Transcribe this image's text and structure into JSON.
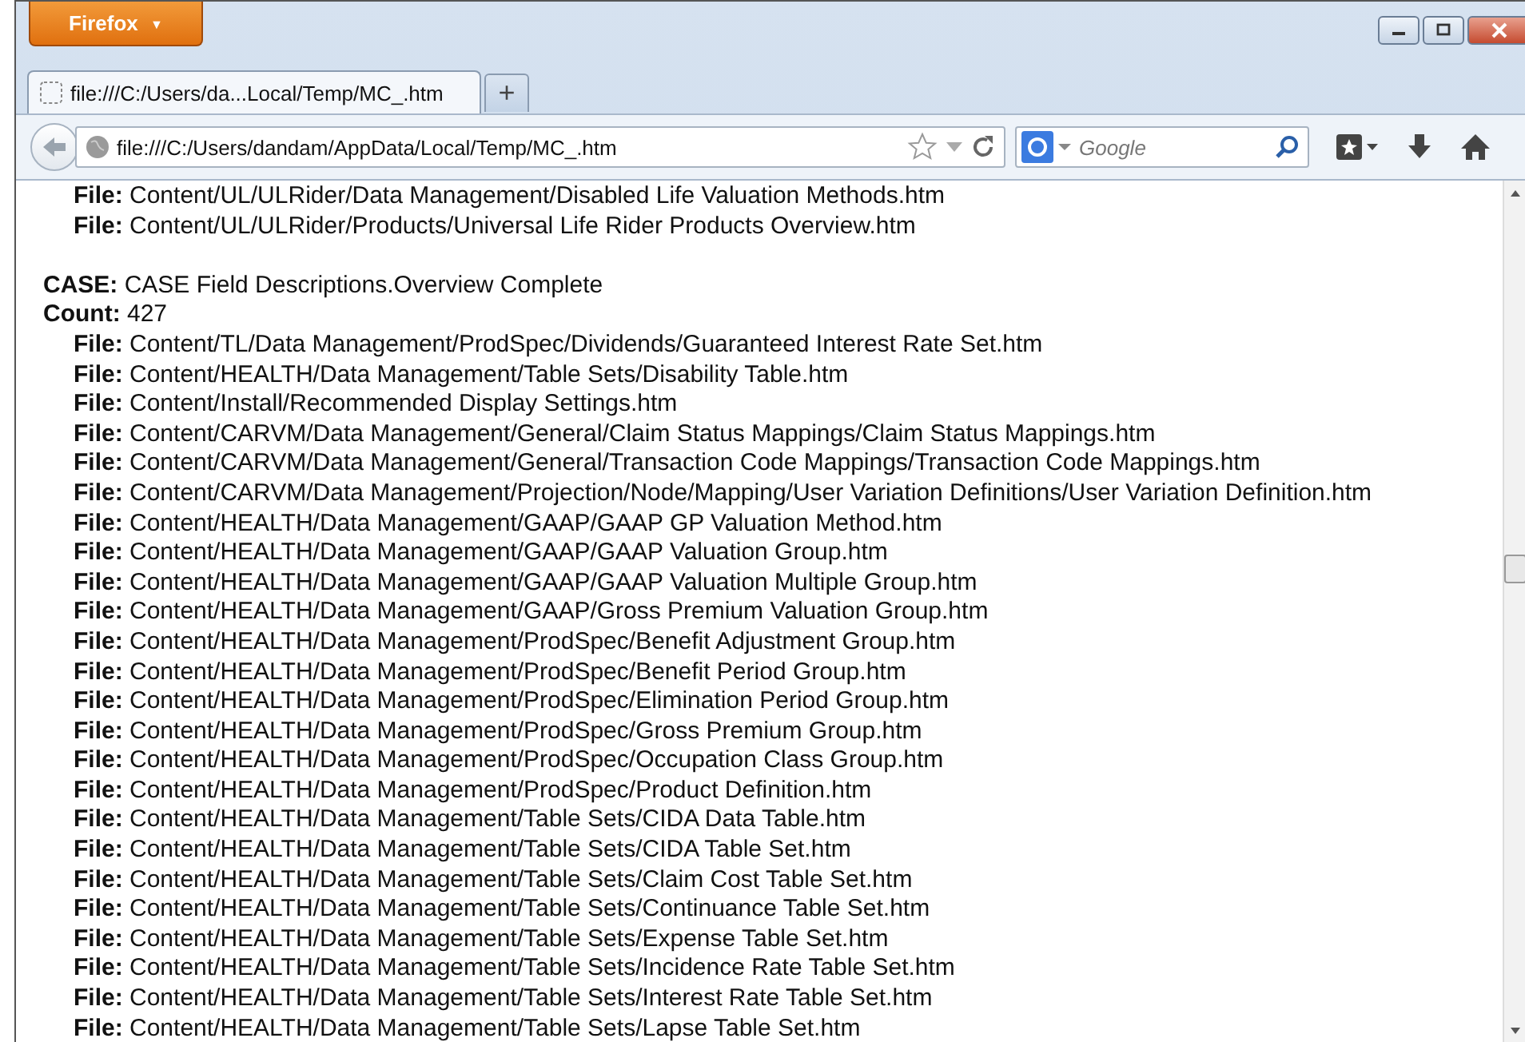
{
  "window": {
    "app_button": "Firefox",
    "app_button_caret": "▼"
  },
  "tabs": [
    {
      "title": "file:///C:/Users/da...Local/Temp/MC_.htm",
      "selected": true
    }
  ],
  "new_tab": "+",
  "navbar": {
    "url": "file:///C:/Users/dandam/AppData/Local/Temp/MC_.htm",
    "search": {
      "placeholder": "Google"
    }
  },
  "sections": [
    {
      "lines": [
        {
          "kind": "file",
          "text": "**File:** Content/UL/ULRider/Data Management/Disabled Life Valuation Methods.htm"
        },
        {
          "kind": "file",
          "text": "**File:** Content/UL/ULRider/Products/Universal Life Rider Products Overview.htm"
        }
      ]
    },
    {
      "lines": [
        {
          "kind": "header",
          "text": "**CASE:** CASE Field Descriptions.Overview Complete"
        },
        {
          "kind": "header",
          "text": "**Count:** 427"
        },
        {
          "kind": "file",
          "text": "**File:** Content/TL/Data Management/ProdSpec/Dividends/Guaranteed Interest Rate Set.htm"
        },
        {
          "kind": "file",
          "text": "**File:** Content/HEALTH/Data Management/Table Sets/Disability Table.htm"
        },
        {
          "kind": "file",
          "text": "**File:** Content/Install/Recommended Display Settings.htm"
        },
        {
          "kind": "file",
          "text": "**File:** Content/CARVM/Data Management/General/Claim Status Mappings/Claim Status Mappings.htm"
        },
        {
          "kind": "file",
          "text": "**File:** Content/CARVM/Data Management/General/Transaction Code Mappings/Transaction Code Mappings.htm"
        },
        {
          "kind": "file",
          "text": "**File:** Content/CARVM/Data Management/Projection/Node/Mapping/User Variation Definitions/User Variation Definition.htm"
        },
        {
          "kind": "file",
          "text": "**File:** Content/HEALTH/Data Management/GAAP/GAAP GP Valuation Method.htm"
        },
        {
          "kind": "file",
          "text": "**File:** Content/HEALTH/Data Management/GAAP/GAAP Valuation Group.htm"
        },
        {
          "kind": "file",
          "text": "**File:** Content/HEALTH/Data Management/GAAP/GAAP Valuation Multiple Group.htm"
        },
        {
          "kind": "file",
          "text": "**File:** Content/HEALTH/Data Management/GAAP/Gross Premium Valuation Group.htm"
        },
        {
          "kind": "file",
          "text": "**File:** Content/HEALTH/Data Management/ProdSpec/Benefit Adjustment Group.htm"
        },
        {
          "kind": "file",
          "text": "**File:** Content/HEALTH/Data Management/ProdSpec/Benefit Period Group.htm"
        },
        {
          "kind": "file",
          "text": "**File:** Content/HEALTH/Data Management/ProdSpec/Elimination Period Group.htm"
        },
        {
          "kind": "file",
          "text": "**File:** Content/HEALTH/Data Management/ProdSpec/Gross Premium Group.htm"
        },
        {
          "kind": "file",
          "text": "**File:** Content/HEALTH/Data Management/ProdSpec/Occupation Class Group.htm"
        },
        {
          "kind": "file",
          "text": "**File:** Content/HEALTH/Data Management/ProdSpec/Product Definition.htm"
        },
        {
          "kind": "file",
          "text": "**File:** Content/HEALTH/Data Management/Table Sets/CIDA Data Table.htm"
        },
        {
          "kind": "file",
          "text": "**File:** Content/HEALTH/Data Management/Table Sets/CIDA Table Set.htm"
        },
        {
          "kind": "file",
          "text": "**File:** Content/HEALTH/Data Management/Table Sets/Claim Cost Table Set.htm"
        },
        {
          "kind": "file",
          "text": "**File:** Content/HEALTH/Data Management/Table Sets/Continuance Table Set.htm"
        },
        {
          "kind": "file",
          "text": "**File:** Content/HEALTH/Data Management/Table Sets/Expense Table Set.htm"
        },
        {
          "kind": "file",
          "text": "**File:** Content/HEALTH/Data Management/Table Sets/Incidence Rate Table Set.htm"
        },
        {
          "kind": "file",
          "text": "**File:** Content/HEALTH/Data Management/Table Sets/Interest Rate Table Set.htm"
        },
        {
          "kind": "file",
          "text": "**File:** Content/HEALTH/Data Management/Table Sets/Lapse Table Set.htm"
        }
      ]
    }
  ]
}
